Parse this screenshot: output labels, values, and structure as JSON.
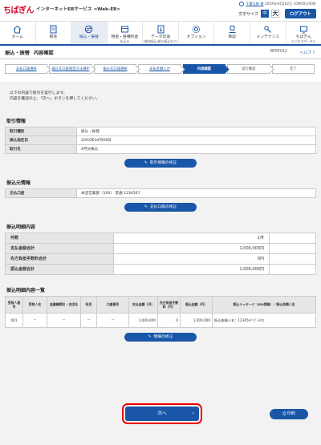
{
  "header": {
    "logo_mark": "ちばぎん",
    "logo_sub": "インターネットEBサービス <Web-EB>",
    "user_name": "千葉太郎 様",
    "last_login": "20XX年04月02日 10時00分00秒",
    "font_size_label": "文字サイズ",
    "font_small": "中",
    "font_large": "大",
    "logout_label": "ログアウト"
  },
  "nav": {
    "items": [
      {
        "label": "ホーム",
        "sub": "",
        "icon": "home-icon"
      },
      {
        "label": "照会",
        "sub": "",
        "icon": "inquiry-icon"
      },
      {
        "label": "振込・振替",
        "sub": "",
        "icon": "transfer-icon"
      },
      {
        "label": "税金・各種料金",
        "sub": "払込み",
        "icon": "tax-payment-icon"
      },
      {
        "label": "データ伝送",
        "sub": "(総合振込/給与振込など)",
        "icon": "data-transfer-icon"
      },
      {
        "label": "オプション",
        "sub": "",
        "icon": "option-icon"
      },
      {
        "label": "承認",
        "sub": "",
        "icon": "approval-icon"
      },
      {
        "label": "メンテナンス",
        "sub": "",
        "icon": "maintenance-icon"
      },
      {
        "label": "ちばぎん",
        "sub": "ビジネスポータル",
        "icon": "portal-icon"
      }
    ]
  },
  "title": {
    "main": "振込・振替",
    "sub": "内容確認",
    "screen_id": "BFKF012",
    "help_label": "ヘルプ"
  },
  "steps": [
    "支払口座選択",
    "振込先口座指定方法選択",
    "振込先口座選択",
    "支払金額入力",
    "内容確認",
    "実行確認",
    "完了"
  ],
  "intro": {
    "line1": "以下の内容で取引を実行します。",
    "line2": "内容を確認の上、「次へ」ボタンを押してください。"
  },
  "transaction": {
    "title": "取引情報",
    "rows": [
      {
        "k": "取引種別",
        "v": "振込・振替"
      },
      {
        "k": "振込指定日",
        "v": "20XX年04月09日"
      },
      {
        "k": "取引名",
        "v": "4月分振込"
      }
    ],
    "btn": "取引情報の修正"
  },
  "source": {
    "title": "振込元情報",
    "rows": [
      {
        "k": "支払口座",
        "v": "本店営業部（100） 普通 1234567"
      }
    ],
    "btn": "支払口座の修正"
  },
  "summary": {
    "title": "振込明細内容",
    "rows": [
      {
        "k": "件数",
        "v": "1件"
      },
      {
        "k": "支払金額合計",
        "v": "1,000,000円"
      },
      {
        "k": "先方負担手数料合計",
        "v": "0円"
      },
      {
        "k": "振込金額合計",
        "v": "1,000,000円"
      }
    ]
  },
  "detail": {
    "title": "振込明細内容一覧",
    "headers": [
      "受取人番号",
      "受取人名",
      "金融機関名・支店名",
      "科目",
      "口座番号",
      "支払金額（円）",
      "先方負担手数料（円）",
      "振込金額（円）",
      "振込メッセージ（EDI情報）／振込依頼人名"
    ],
    "rows": [
      [
        "001",
        "－",
        "－",
        "－",
        "－",
        "1,000,000",
        "0",
        "1,000,000",
        "振込依頼人名：12345ﾁﾊﾞﾀﾞｲ3ﾘｽ"
      ]
    ],
    "btn": "明細の修正"
  },
  "footer": {
    "next_label": "次へ",
    "print_label": "印刷"
  },
  "colors": {
    "accent": "#1a56a8",
    "brand": "#c8102e"
  }
}
